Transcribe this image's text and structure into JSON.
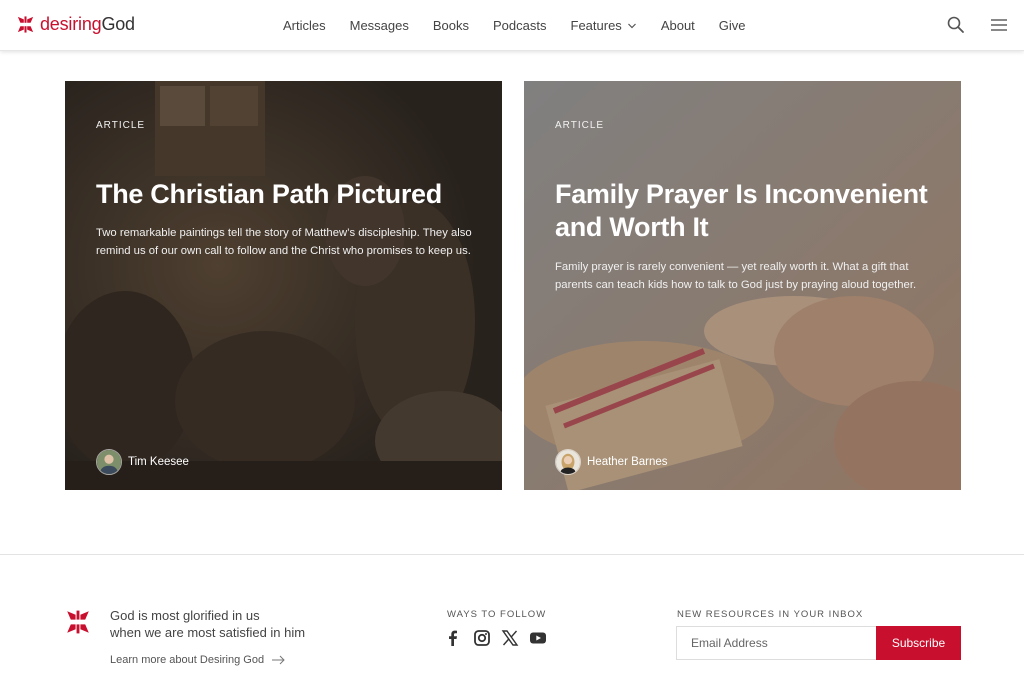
{
  "header": {
    "logo_word1": "desiring",
    "logo_word2": "God",
    "nav": [
      "Articles",
      "Messages",
      "Books",
      "Podcasts",
      "Features",
      "About",
      "Give"
    ],
    "search_icon": "search-icon",
    "menu_icon": "hamburger-menu-icon"
  },
  "cards": [
    {
      "eyebrow": "ARTICLE",
      "title": "The Christian Path Pictured",
      "description": "Two remarkable paintings tell the story of Matthew’s discipleship. They also remind us of our own call to follow and the Christ who promises to keep us.",
      "author": "Tim Keesee"
    },
    {
      "eyebrow": "ARTICLE",
      "title": "Family Prayer Is Inconvenient and Worth It",
      "description": "Family prayer is rarely convenient — yet really worth it. What a gift that parents can teach kids how to talk to God just by praying aloud together.",
      "author": "Heather Barnes"
    }
  ],
  "footer": {
    "tagline_line1": "God is most glorified in us",
    "tagline_line2": "when we are most satisfied in him",
    "learn_more": "Learn more about Desiring God",
    "follow_heading": "WAYS TO FOLLOW",
    "social_icons": [
      "facebook-icon",
      "instagram-icon",
      "x-icon",
      "youtube-icon"
    ],
    "newsletter_heading": "NEW RESOURCES IN YOUR INBOX",
    "email_placeholder": "Email Address",
    "subscribe_label": "Subscribe"
  },
  "colors": {
    "brand_red": "#c8102e"
  }
}
